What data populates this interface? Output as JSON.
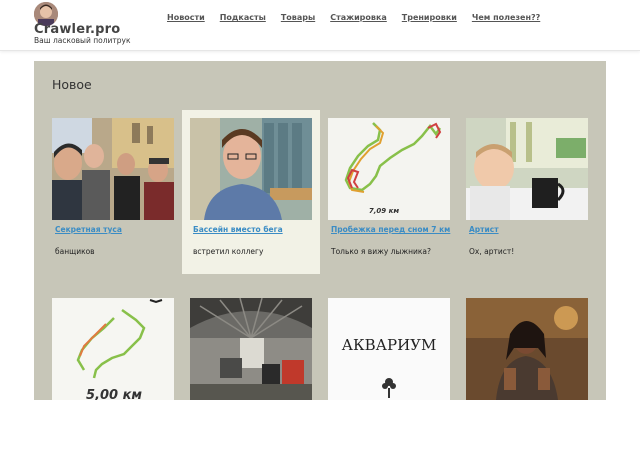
{
  "header": {
    "site_title": "Crawler.pro",
    "tagline": "Ваш ласковый политрук",
    "nav": [
      {
        "label": "Новости"
      },
      {
        "label": "Подкасты"
      },
      {
        "label": "Товары"
      },
      {
        "label": "Стажировка"
      },
      {
        "label": "Тренировки"
      },
      {
        "label": "Чем полезен??"
      }
    ]
  },
  "main": {
    "section_title": "Новое",
    "cards": [
      {
        "title": "Секретная туса",
        "desc": "банщиков",
        "image": "group-selfie"
      },
      {
        "title": "Бассейн вместо бега",
        "desc": "встретил коллегу",
        "image": "locker-room-selfie"
      },
      {
        "title": "Пробежка перед сном 7 км",
        "desc": "Только я вижу лыжника?",
        "image": "run-route-map",
        "map_label": "7,09 км"
      },
      {
        "title": "Артист",
        "desc": "Ох, артист!",
        "image": "child-with-mug"
      },
      {
        "title": "",
        "desc": "",
        "image": "run-route-map",
        "map_label": "5,00 км"
      },
      {
        "title": "",
        "desc": "",
        "image": "train-station"
      },
      {
        "title": "",
        "desc": "",
        "image": "book-cover",
        "cover_text": "АКВАРИУМ"
      },
      {
        "title": "",
        "desc": "",
        "image": "game-character"
      }
    ]
  },
  "colors": {
    "panel_bg": "#c7c6b8",
    "highlight_card": "#f2f2e6",
    "link": "#3b8cc4"
  }
}
